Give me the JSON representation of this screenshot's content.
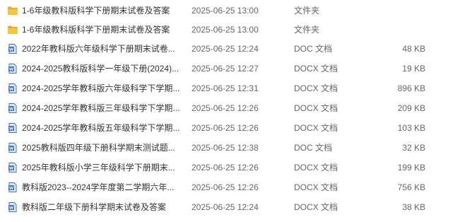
{
  "files": [
    {
      "name": "1-6年级教科版科学下册期末试卷及答案",
      "date": "2025-06-25 13:00",
      "type": "文件夹",
      "size": "",
      "icon": "folder-icon"
    },
    {
      "name": "1-6年级教科版科学下册期末试卷及答案",
      "date": "2025-06-25 13:00",
      "type": "文件夹",
      "size": "",
      "icon": "folder-icon"
    },
    {
      "name": "2022年教科版六年级科学下册期末试卷...",
      "date": "2025-06-25 12:24",
      "type": "DOC 文档",
      "size": "48 KB",
      "icon": "doc-file-icon"
    },
    {
      "name": "2024-2025教科版科学一年级下册(2024)...",
      "date": "2025-06-25 12:27",
      "type": "DOCX 文档",
      "size": "19 KB",
      "icon": "docx-file-icon"
    },
    {
      "name": "2024-2025学年教科版六年级科学下学期...",
      "date": "2025-06-25 12:31",
      "type": "DOCX 文档",
      "size": "896 KB",
      "icon": "docx-file-icon"
    },
    {
      "name": "2024-2025学年教科版三年级科学下学期...",
      "date": "2025-06-25 12:26",
      "type": "DOCX 文档",
      "size": "209 KB",
      "icon": "docx-file-icon"
    },
    {
      "name": "2024-2025学年教科版五年级科学下学期...",
      "date": "2025-06-25 12:26",
      "type": "DOCX 文档",
      "size": "103 KB",
      "icon": "docx-file-icon"
    },
    {
      "name": "2025教科版四年级下册科学期末测试题...",
      "date": "2025-06-25 12:38",
      "type": "DOC 文档",
      "size": "32 KB",
      "icon": "doc-file-icon"
    },
    {
      "name": "2025年教科版小学三年级科学下册期末...",
      "date": "2025-06-25 12:26",
      "type": "DOCX 文档",
      "size": "199 KB",
      "icon": "docx-file-icon"
    },
    {
      "name": "教科版2023--2024学年度第二学期六年...",
      "date": "2025-06-25 12:26",
      "type": "DOCX 文档",
      "size": "756 KB",
      "icon": "docx-file-icon"
    },
    {
      "name": "教科版二年级下册科学期末试卷及答案",
      "date": "2025-06-25 12:24",
      "type": "DOCX 文档",
      "size": "38 KB",
      "icon": "docx-file-icon"
    }
  ],
  "colors": {
    "folder": "#F5C542",
    "folder_tab": "#E8B020",
    "doc": "#3B6FD6",
    "doc_light": "#E6EEFB"
  }
}
